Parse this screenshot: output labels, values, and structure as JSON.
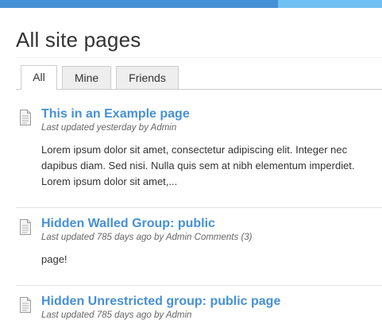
{
  "page": {
    "title": "All site pages"
  },
  "tabs": [
    {
      "label": "All",
      "selected": true
    },
    {
      "label": "Mine",
      "selected": false
    },
    {
      "label": "Friends",
      "selected": false
    }
  ],
  "items": [
    {
      "title": "This in an Example page",
      "meta": "Last updated yesterday by Admin",
      "body": [
        "Lorem ipsum dolor sit amet, consectetur adipiscing elit. Integer nec",
        "dapibus diam. Sed nisi. Nulla quis sem at nibh elementum imperdiet.",
        "Lorem ipsum dolor sit amet,..."
      ]
    },
    {
      "title": "Hidden Walled Group: public",
      "meta": "Last updated 785 days ago by Admin Comments (3)",
      "body": [
        "page!"
      ]
    },
    {
      "title": "Hidden Unrestricted group: public page",
      "meta": "Last updated 785 days ago by Admin",
      "body": []
    }
  ],
  "colors": {
    "header_bar": "#4690d6",
    "header_accent": "#6fbff2",
    "link": "#4690d6"
  },
  "icons": {
    "item_icon": "page-document-icon"
  }
}
